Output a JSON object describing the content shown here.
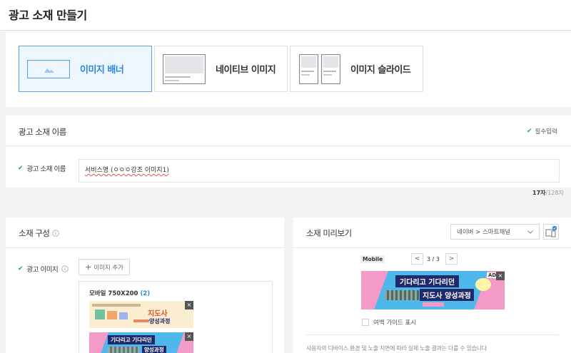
{
  "page": {
    "title": "광고 소재 만들기"
  },
  "creative_types": [
    {
      "label": "이미지 배너",
      "active": true
    },
    {
      "label": "네이티브 이미지",
      "active": false
    },
    {
      "label": "이미지 슬라이드",
      "active": false
    }
  ],
  "name_section": {
    "title": "광고 소재 이름",
    "required_label": "필수입력",
    "field_label": "광고 소재 이름",
    "value": "서비스명 (ㅇㅇㅇ강조 이미지1)",
    "counter_current": "17자",
    "counter_max": "/128자"
  },
  "composition": {
    "title": "소재 구성",
    "image_label": "광고 이미지",
    "add_button": "이미지 추가",
    "list_title": "모바일 750X200",
    "list_count": "(2)",
    "thumb1_text_a": "지도사",
    "thumb1_text_b": "양성과정",
    "thumb1_close": "×",
    "thumb2_text_a": "기다리고 기다리던",
    "thumb2_text_b": "양성과정",
    "thumb2_close": "×"
  },
  "preview": {
    "title": "소재 미리보기",
    "select_value": "네이버 > 스마트채널",
    "mobile_label": "Mobile",
    "page_indicator": "3 / 3",
    "prev_button": "<",
    "next_button": ">",
    "ad_badge": "AD",
    "ad_close": "×",
    "ad_line1": "기다리고 기다리던",
    "ad_line2": "지도사 양성과정",
    "guide_label": "여백 가이드 표시",
    "disclaimer": "사용자의 디바이스 환경 및 노출 지면에 따라 실제 노출 결과는 다를 수 있습니다"
  },
  "colors": {
    "accent": "#2e86de",
    "check_green": "#2aa05a",
    "banner_blue": "#4fb8ea",
    "banner_pink": "#f49ac8",
    "banner_navy": "#1e2a6b"
  }
}
